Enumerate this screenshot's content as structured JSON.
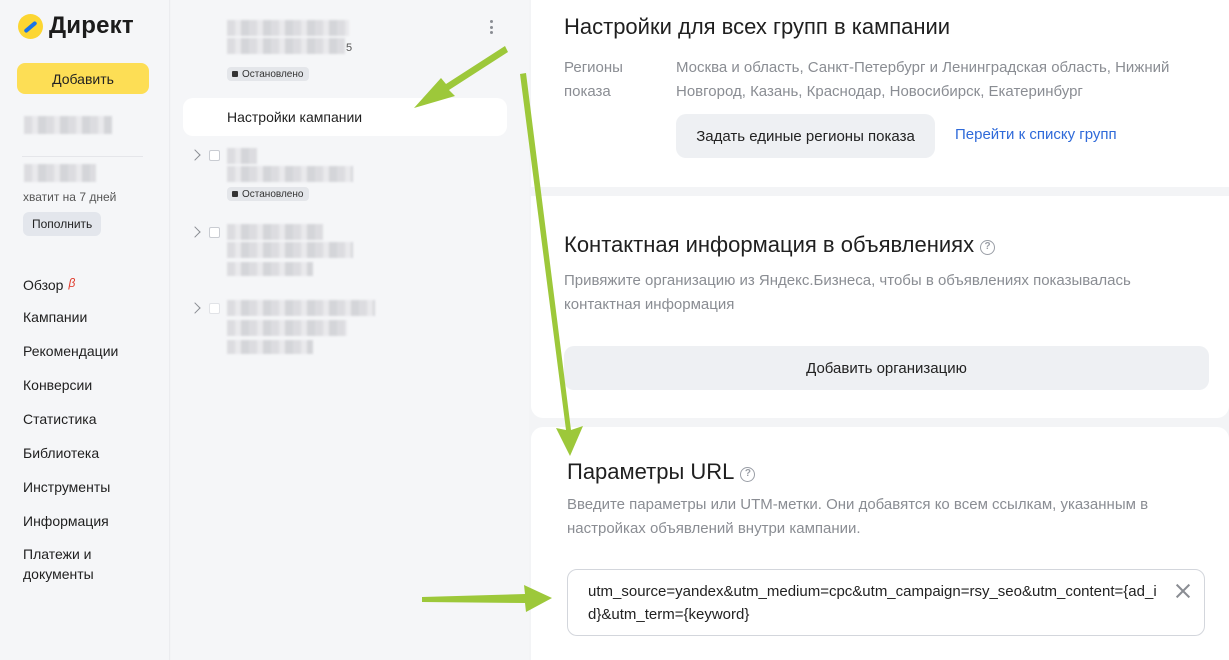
{
  "nav": {
    "logo_text": "Директ",
    "add_button": "Добавить",
    "balance_days": "хватит на 7 дней",
    "topup_button": "Пополнить",
    "beta_mark": "β",
    "items": [
      {
        "label": "Обзор"
      },
      {
        "label": "Кампании"
      },
      {
        "label": "Рекомендации"
      },
      {
        "label": "Конверсии"
      },
      {
        "label": "Статистика"
      },
      {
        "label": "Библиотека"
      },
      {
        "label": "Инструменты"
      },
      {
        "label": "Информация"
      },
      {
        "label": "Платежи и документы"
      }
    ]
  },
  "tree": {
    "campaign_suffix": "5",
    "status_stopped": "Остановлено",
    "settings_item": "Настройки кампании"
  },
  "section_all_groups": {
    "title": "Настройки для всех групп в кампании",
    "regions_label": "Регионы показа",
    "regions_value": "Москва и область, Санкт-Петербург и Ленинградская область, Нижний Новгород, Казань, Краснодар, Новосибирск, Екатеринбург",
    "set_regions_button": "Задать единые регионы показа",
    "groups_link": "Перейти к списку групп"
  },
  "section_contacts": {
    "title": "Контактная информация в объявлениях",
    "description": "Привяжите организацию из Яндекс.Бизнеса, чтобы в объявлениях показывалась контактная информация",
    "add_org_button": "Добавить организацию"
  },
  "section_url": {
    "title": "Параметры URL",
    "description": "Введите параметры или UTM-метки. Они добавятся ко всем ссылкам, указанным в настройках объявлений внутри кампании.",
    "value": "utm_source=yandex&utm_medium=cpc&utm_campaign=rsy_seo&utm_content={ad_id}&utm_term={keyword}"
  },
  "colors": {
    "accent_yellow": "#fdde55",
    "link_blue": "#2f6ad9",
    "annotation_arrow": "#9dc83a"
  }
}
